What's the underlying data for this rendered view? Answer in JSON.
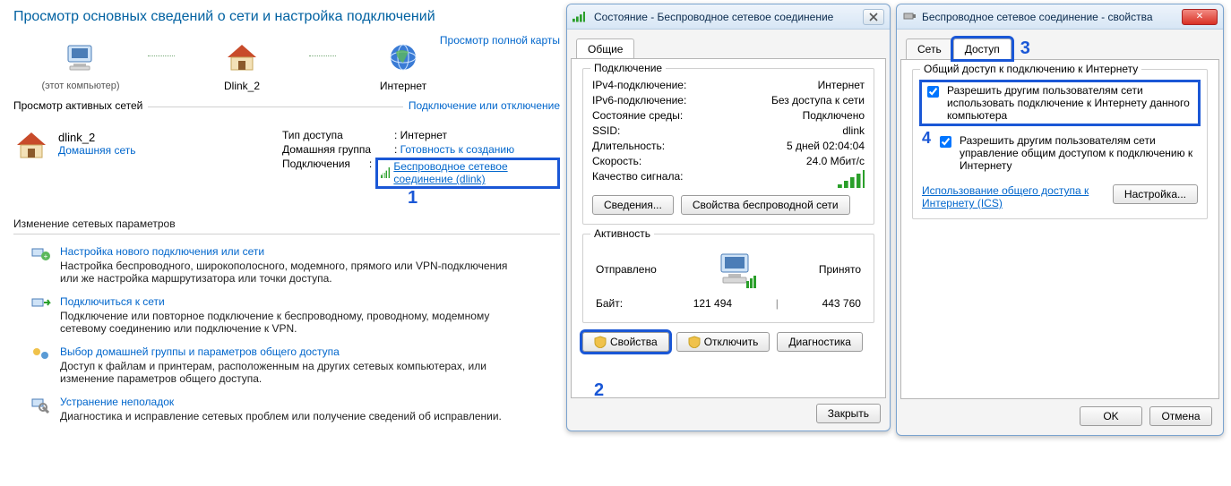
{
  "netcenter": {
    "title": "Просмотр основных сведений о сети и настройка подключений",
    "fullmap": "Просмотр полной карты",
    "nodes": {
      "pc_label": "(этот компьютер)",
      "router_label": "Dlink_2",
      "internet_label": "Интернет"
    },
    "active_hdr": "Просмотр активных сетей",
    "connect_link": "Подключение или отключение",
    "active": {
      "name": "dlink_2",
      "type": "Домашняя сеть",
      "k_access": "Тип доступа",
      "v_access": "Интернет",
      "k_hg": "Домашняя группа",
      "v_hg": "Готовность к созданию",
      "k_conn": "Подключения",
      "v_conn": "Беспроводное сетевое соединение (dlink)"
    },
    "callout1": "1",
    "params_hdr": "Изменение сетевых параметров",
    "tasks": [
      {
        "title": "Настройка нового подключения или сети",
        "desc": "Настройка беспроводного, широкополосного, модемного, прямого или VPN-подключения или же настройка маршрутизатора или точки доступа."
      },
      {
        "title": "Подключиться к сети",
        "desc": "Подключение или повторное подключение к беспроводному, проводному, модемному сетевому соединению или подключение к VPN."
      },
      {
        "title": "Выбор домашней группы и параметров общего доступа",
        "desc": "Доступ к файлам и принтерам, расположенным на других сетевых компьютерах, или изменение параметров общего доступа."
      },
      {
        "title": "Устранение неполадок",
        "desc": "Диагностика и исправление сетевых проблем или получение сведений об исправлении."
      }
    ]
  },
  "status": {
    "title": "Состояние - Беспроводное сетевое соединение",
    "tab": "Общие",
    "grp_conn": "Подключение",
    "kv": {
      "ipv4_k": "IPv4-подключение",
      "ipv4_v": "Интернет",
      "ipv6_k": "IPv6-подключение",
      "ipv6_v": "Без доступа к сети",
      "media_k": "Состояние среды",
      "media_v": "Подключено",
      "ssid_k": "SSID",
      "ssid_v": "dlink",
      "dur_k": "Длительность",
      "dur_v": "5 дней 02:04:04",
      "spd_k": "Скорость",
      "spd_v": "24.0 Мбит/с",
      "sig_k": "Качество сигнала"
    },
    "btn_details": "Сведения...",
    "btn_wprops": "Свойства беспроводной сети",
    "grp_act": "Активность",
    "sent": "Отправлено",
    "recv": "Принято",
    "bytes_label": "Байт:",
    "bytes_sent": "121 494",
    "bytes_recv": "443 760",
    "btn_props": "Свойства",
    "btn_disable": "Отключить",
    "btn_diag": "Диагностика",
    "btn_close": "Закрыть",
    "callout2": "2"
  },
  "props": {
    "title": "Беспроводное сетевое соединение - свойства",
    "tab_net": "Сеть",
    "tab_access": "Доступ",
    "callout3": "3",
    "grp": "Общий доступ к подключению к Интернету",
    "chk1": "Разрешить другим пользователям сети использовать подключение к Интернету данного компьютера",
    "chk2": "Разрешить другим пользователям сети управление общим доступом к подключению к Интернету",
    "callout4": "4",
    "ics_link": "Использование общего доступа к Интернету (ICS)",
    "btn_settings": "Настройка...",
    "btn_ok": "OK",
    "btn_cancel": "Отмена"
  }
}
